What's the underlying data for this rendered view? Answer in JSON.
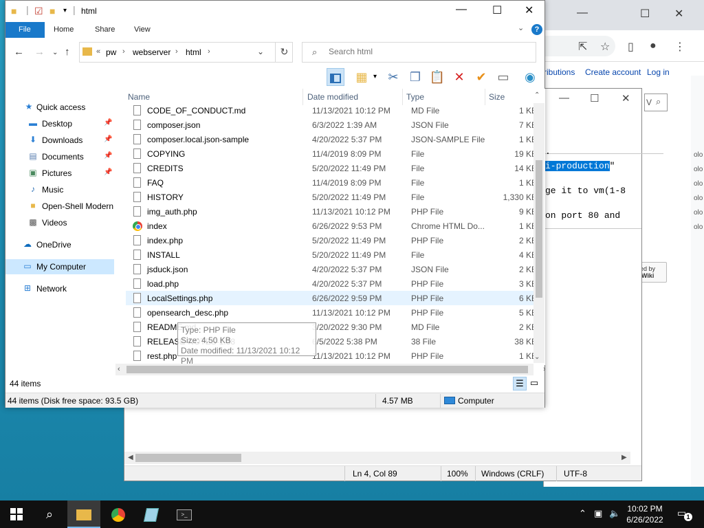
{
  "explorer": {
    "title": "html",
    "tabs": [
      "File",
      "Home",
      "Share",
      "View"
    ],
    "breadcrumb": [
      "pw",
      "webserver",
      "html"
    ],
    "breadcrumb_overflow": "«",
    "search_placeholder": "Search html",
    "columns": {
      "name": "Name",
      "date": "Date modified",
      "type": "Type",
      "size": "Size"
    },
    "nav": {
      "quick_access": "Quick access",
      "desktop": "Desktop",
      "downloads": "Downloads",
      "documents": "Documents",
      "pictures": "Pictures",
      "music": "Music",
      "open_shell": "Open-Shell Modern",
      "videos": "Videos",
      "onedrive": "OneDrive",
      "my_computer": "My Computer",
      "network": "Network"
    },
    "files": [
      {
        "name": "CODE_OF_CONDUCT.md",
        "date": "11/13/2021 10:12 PM",
        "type": "MD File",
        "size": "1 KB",
        "icon": "file-icon"
      },
      {
        "name": "composer.json",
        "date": "6/3/2022 1:39 AM",
        "type": "JSON File",
        "size": "7 KB",
        "icon": "file-icon"
      },
      {
        "name": "composer.local.json-sample",
        "date": "4/20/2022 5:37 PM",
        "type": "JSON-SAMPLE File",
        "size": "1 KB",
        "icon": "file-icon"
      },
      {
        "name": "COPYING",
        "date": "11/4/2019 8:09 PM",
        "type": "File",
        "size": "19 KB",
        "icon": "file-icon"
      },
      {
        "name": "CREDITS",
        "date": "5/20/2022 11:49 PM",
        "type": "File",
        "size": "14 KB",
        "icon": "file-icon"
      },
      {
        "name": "FAQ",
        "date": "11/4/2019 8:09 PM",
        "type": "File",
        "size": "1 KB",
        "icon": "file-icon"
      },
      {
        "name": "HISTORY",
        "date": "5/20/2022 11:49 PM",
        "type": "File",
        "size": "1,330 KB",
        "icon": "file-icon"
      },
      {
        "name": "img_auth.php",
        "date": "11/13/2021 10:12 PM",
        "type": "PHP File",
        "size": "9 KB",
        "icon": "file-icon"
      },
      {
        "name": "index",
        "date": "6/26/2022 9:53 PM",
        "type": "Chrome HTML Do...",
        "size": "1 KB",
        "icon": "chrome-icon"
      },
      {
        "name": "index.php",
        "date": "5/20/2022 11:49 PM",
        "type": "PHP File",
        "size": "2 KB",
        "icon": "file-icon"
      },
      {
        "name": "INSTALL",
        "date": "5/20/2022 11:49 PM",
        "type": "File",
        "size": "4 KB",
        "icon": "file-icon"
      },
      {
        "name": "jsduck.json",
        "date": "4/20/2022 5:37 PM",
        "type": "JSON File",
        "size": "2 KB",
        "icon": "file-icon"
      },
      {
        "name": "load.php",
        "date": "4/20/2022 5:37 PM",
        "type": "PHP File",
        "size": "3 KB",
        "icon": "file-icon"
      },
      {
        "name": "LocalSettings.php",
        "date": "6/26/2022 9:59 PM",
        "type": "PHP File",
        "size": "6 KB",
        "icon": "file-icon"
      },
      {
        "name": "opensearch_desc.php",
        "date": "11/13/2021 10:12 PM",
        "type": "PHP File",
        "size": "5 KB",
        "icon": "file-icon"
      },
      {
        "name": "README.md",
        "date": "3/20/2022 9:30 PM",
        "type": "MD File",
        "size": "2 KB",
        "icon": "file-icon"
      },
      {
        "name": "RELEASE-NOTES-1.38",
        "date": "6/5/2022 5:38 PM",
        "type": "38 File",
        "size": "38 KB",
        "icon": "file-icon"
      },
      {
        "name": "rest.php",
        "date": "11/13/2021 10:12 PM",
        "type": "PHP File",
        "size": "1 KB",
        "icon": "file-icon"
      }
    ],
    "tooltip": {
      "type": "Type: PHP File",
      "size": "Size: 4.50 KB",
      "date": "Date modified: 11/13/2021 10:12 PM"
    },
    "item_count": "44 items",
    "status": {
      "summary": "44 items (Disk free space: 93.5 GB)",
      "size": "4.57 MB",
      "location": "Computer"
    }
  },
  "notepad": {
    "find_text": "V",
    "line1": ".",
    "line2_hl": "i-production",
    "line2_tail": "\"",
    "line3": "ge it to vm(1-8",
    "line4": "on port 80 and",
    "status": {
      "position": "Ln 4, Col 89",
      "zoom": "100%",
      "eol": "Windows (CRLF)",
      "encoding": "UTF-8"
    }
  },
  "chrome": {
    "nav_contributions": "ributions",
    "nav_create_account": "Create account",
    "nav_login": "Log in",
    "powered_by_1": "ered by",
    "powered_by_2": "liaWiki",
    "side_text": [
      "olo",
      "olo",
      "olo",
      "olo",
      "olo",
      "olo"
    ]
  },
  "taskbar": {
    "time": "10:02 PM",
    "date": "6/26/2022",
    "notification_count": "1"
  },
  "colors": {
    "accent": "#1979ca",
    "selection": "#cce8ff",
    "highlight": "#0078d7"
  }
}
